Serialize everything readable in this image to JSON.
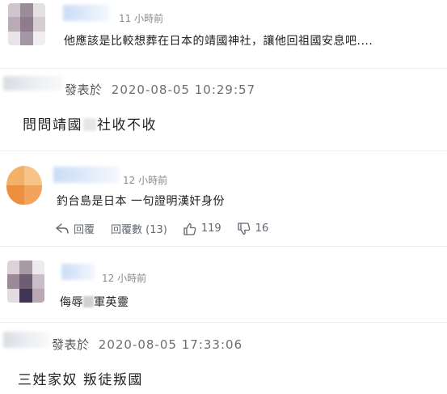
{
  "comment1": {
    "time": "11 小時前",
    "text": "他應該是比較想葬在日本的靖國神社，讓他回祖國安息吧...."
  },
  "post1": {
    "posted_label": "發表於",
    "date": "2020-08-05 10:29:57",
    "text_a": "問問靖國",
    "text_b": "社收不收"
  },
  "comment2": {
    "time": "12 小時前",
    "text": "釣台島是日本 一句證明漢奸身份",
    "reply_label": "回覆",
    "reply_count_label": "回覆數 (13)",
    "likes": "119",
    "dislikes": "16",
    "icons": {
      "reply": "reply-arrow-icon",
      "like": "thumbs-up-icon",
      "dislike": "thumbs-down-icon"
    }
  },
  "comment3": {
    "time": "12 小時前",
    "text_a": "侮辱",
    "text_b": "軍英靈"
  },
  "post2": {
    "posted_label": "發表於",
    "date": "2020-08-05 17:33:06",
    "text": "三姓家奴 叛徒叛國"
  }
}
